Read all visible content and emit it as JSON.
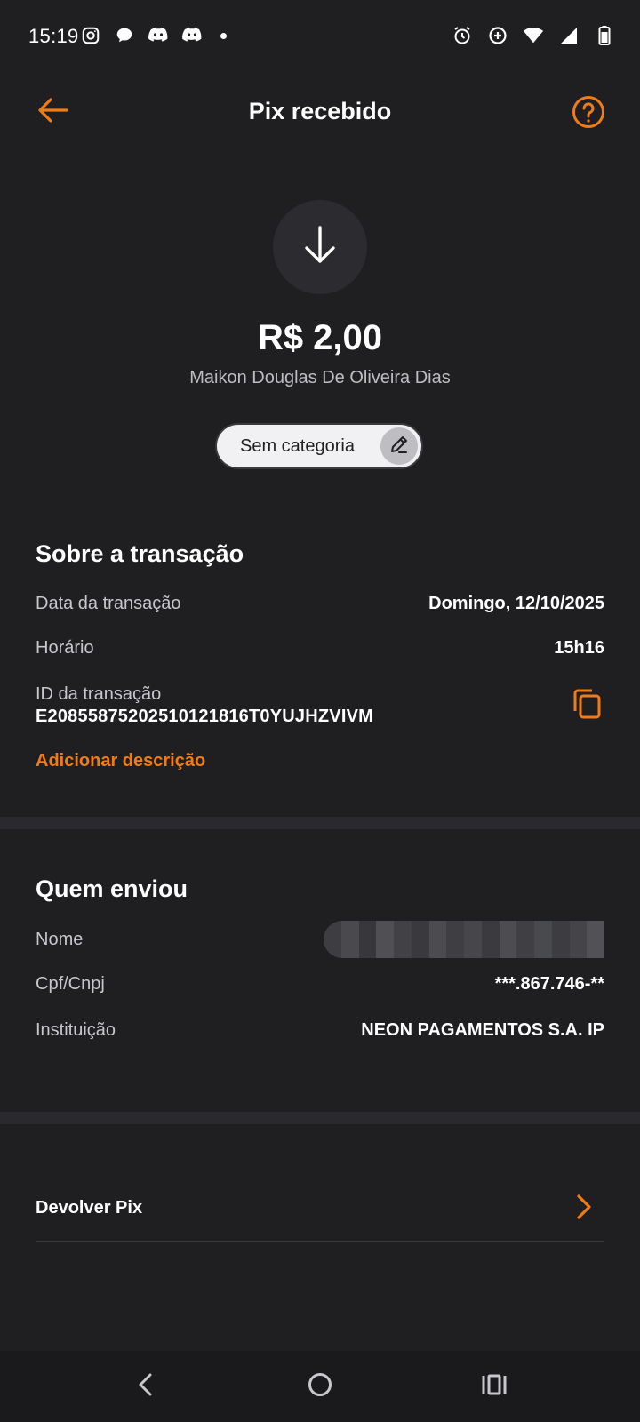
{
  "status_bar": {
    "time": "15:19",
    "left_icons": [
      "instagram-icon",
      "chat-bubble-icon",
      "discord-icon",
      "discord-icon",
      "notification-dot"
    ],
    "right_icons": [
      "alarm-icon",
      "data-saver-icon",
      "wifi-icon",
      "signal-icon",
      "battery-icon"
    ]
  },
  "header": {
    "title": "Pix recebido",
    "back_icon": "arrow-left-icon",
    "help_icon": "help-circle-icon"
  },
  "summary": {
    "direction_icon": "arrow-down-icon",
    "amount": "R$ 2,00",
    "payer_name": "Maikon Douglas De Oliveira Dias",
    "category": "Sem categoria",
    "category_edit_icon": "pencil-icon"
  },
  "transaction": {
    "title": "Sobre a transação",
    "date_label": "Data da transação",
    "date_value": "Domingo, 12/10/2025",
    "time_label": "Horário",
    "time_value": "15h16",
    "id_label": "ID da transação",
    "id_value": "E20855875202510121816T0YUJHZVIVM",
    "copy_icon": "copy-icon",
    "add_description": "Adicionar descrição"
  },
  "sender": {
    "title": "Quem enviou",
    "name_label": "Nome",
    "name_value_redacted": true,
    "doc_label": "Cpf/Cnpj",
    "doc_value": "***.867.746-**",
    "institution_label": "Instituição",
    "institution_value": "NEON PAGAMENTOS S.A. IP"
  },
  "actions": {
    "return_pix": "Devolver Pix",
    "return_icon": "chevron-right-icon"
  },
  "colors": {
    "accent": "#f07c17",
    "background": "#1f1f22",
    "surface": "#2c2c30",
    "text_secondary": "#c7c7cc"
  }
}
